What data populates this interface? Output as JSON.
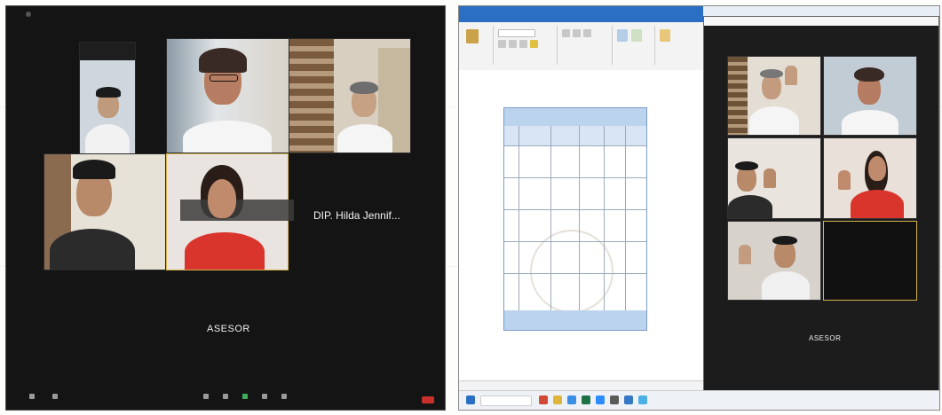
{
  "left_meeting": {
    "top_right": [
      "",
      ""
    ],
    "tiles": [
      {
        "label": ""
      },
      {
        "label": ""
      },
      {
        "label": ""
      },
      {
        "label": ""
      },
      {
        "label": ""
      }
    ],
    "caption_text": "",
    "participant_name": "DIP. Hilda Jennif...",
    "advisor_label": "ASESOR",
    "controls": [
      "",
      "",
      "",
      "",
      "",
      "",
      ""
    ]
  },
  "right_screen": {
    "ribbon_tabs": [
      "",
      "",
      "",
      "",
      "",
      "",
      ""
    ],
    "zoom_advisor_label": "ASESOR",
    "taskbar_search": ""
  },
  "colors": {
    "zoom_bg": "#141414",
    "excel_blue": "#2b6fc4",
    "table_header": "#bcd3ee",
    "active_speaker_border": "#d4b24c",
    "end_red": "#c9302c"
  }
}
